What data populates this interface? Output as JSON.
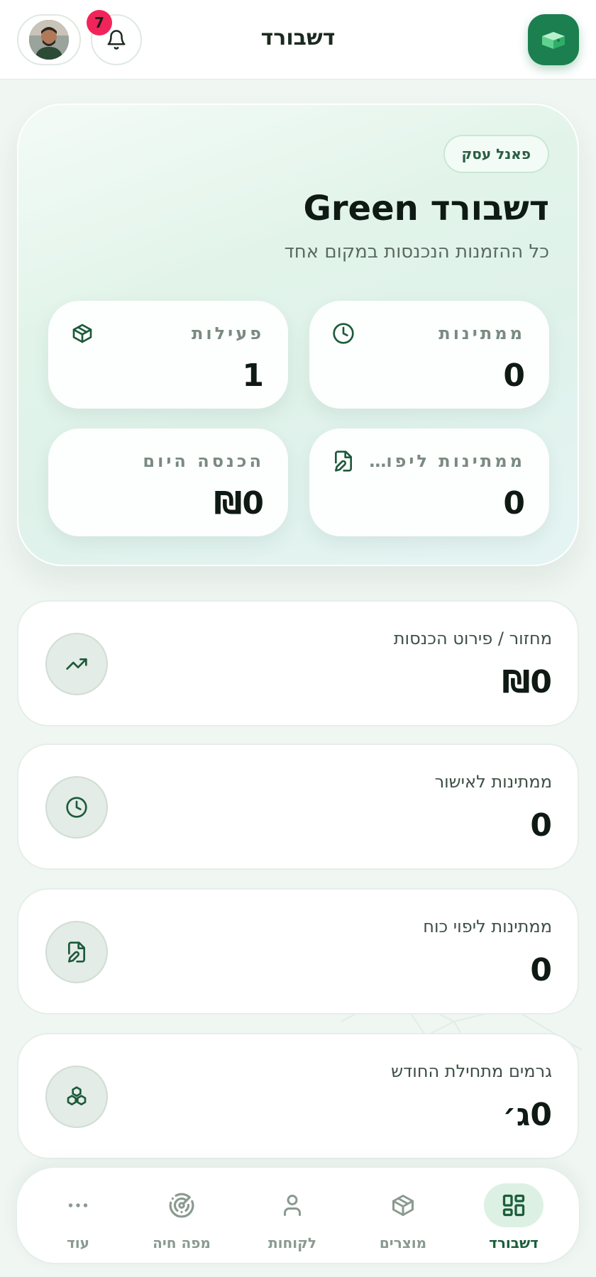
{
  "header": {
    "title": "דשבורד",
    "notification_count": "7"
  },
  "hero": {
    "pill": "פאנל עסק",
    "title": "דשבורד Green",
    "subtitle": "כל ההזמנות הנכנסות במקום אחד",
    "stats": [
      {
        "label": "ממתינות",
        "value": "0",
        "icon": "clock-icon"
      },
      {
        "label": "פעילות",
        "value": "1",
        "icon": "package-icon"
      },
      {
        "label": "ממתינות ליפוי כוח",
        "value": "0",
        "icon": "file-edit-icon"
      },
      {
        "label": "הכנסה היום",
        "value": "₪0",
        "icon": ""
      }
    ]
  },
  "cards": [
    {
      "label": "מחזור / פירוט הכנסות",
      "value": "₪0",
      "icon": "trending-up-icon"
    },
    {
      "label": "ממתינות לאישור",
      "value": "0",
      "icon": "clock-icon"
    },
    {
      "label": "ממתינות ליפוי כוח",
      "value": "0",
      "icon": "file-edit-icon"
    },
    {
      "label": "גרמים מתחילת החודש",
      "value": "0ג׳",
      "icon": "boxes-icon"
    }
  ],
  "nav": [
    {
      "label": "דשבורד",
      "icon": "dashboard-icon",
      "active": true
    },
    {
      "label": "מוצרים",
      "icon": "package-icon",
      "active": false
    },
    {
      "label": "לקוחות",
      "icon": "user-icon",
      "active": false
    },
    {
      "label": "מפה חיה",
      "icon": "radar-icon",
      "active": false
    },
    {
      "label": "עוד",
      "icon": "more-icon",
      "active": false
    }
  ],
  "colors": {
    "brand": "#1b7f4f",
    "badge": "#f0245a",
    "active_nav_bg": "#ddf0e4"
  }
}
